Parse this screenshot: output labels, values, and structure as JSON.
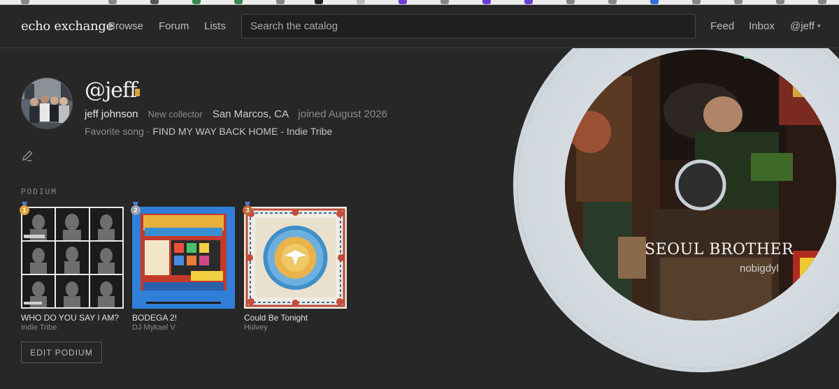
{
  "nav": {
    "logo": "echo exchange",
    "links": [
      "Browse",
      "Forum",
      "Lists"
    ],
    "search_placeholder": "Search the catalog",
    "right": [
      "Feed",
      "Inbox",
      "@jeff"
    ]
  },
  "profile": {
    "handle": "@jeff",
    "name": "jeff johnson",
    "collector_level": "New collector",
    "location": "San Marcos, CA",
    "joined": "joined August 2026",
    "favorite_prefix": "Favorite song ·",
    "favorite_song": "FIND MY WAY BACK HOME - Indie Tribe"
  },
  "podium": {
    "label": "PODIUM",
    "items": [
      {
        "rank": "1",
        "title": "WHO DO YOU SAY I AM?",
        "artist": "Indie Tribe",
        "rank_color": "#e3a13a"
      },
      {
        "rank": "2",
        "title": "BODEGA 2!",
        "artist": "DJ Mykael V",
        "rank_color": "#9aa3ad"
      },
      {
        "rank": "3",
        "title": "Could Be Tonight",
        "artist": "Hulvey",
        "rank_color": "#c0673a"
      }
    ],
    "edit_label": "EDIT PODIUM"
  },
  "featured": {
    "title": "SEOUL BROTHER",
    "artist": "nobigdyl"
  },
  "colors": {
    "background": "#272727",
    "accent_gold": "#e3a13a"
  }
}
